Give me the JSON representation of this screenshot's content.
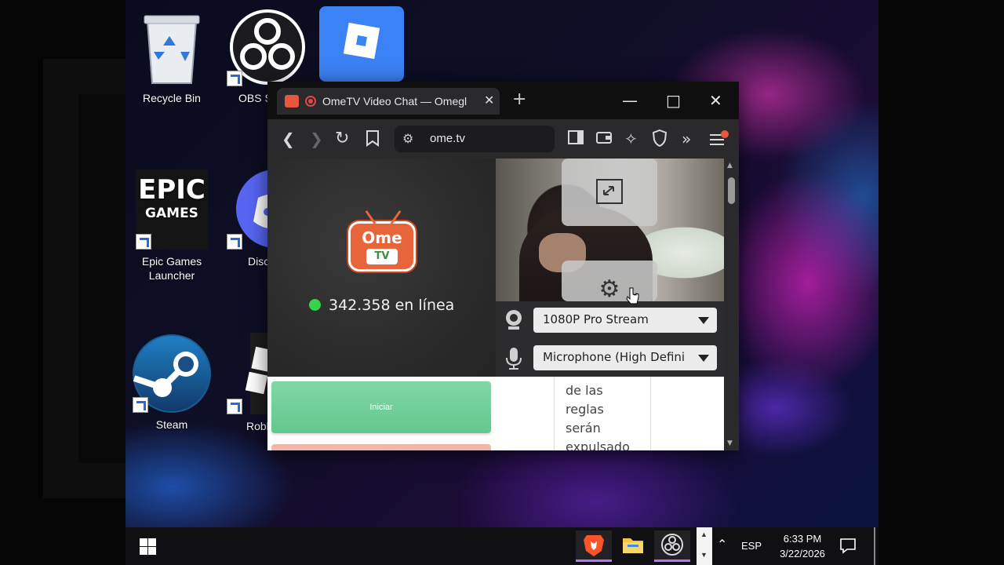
{
  "desktop": {
    "icons": [
      {
        "label": "Recycle Bin"
      },
      {
        "label": "OBS S"
      },
      {
        "label": "Epic Games Launcher"
      },
      {
        "label": "Disc"
      },
      {
        "label": "Steam"
      },
      {
        "label": "Roblox"
      }
    ],
    "epic_logo": {
      "line1": "EPIC",
      "line2": "GAMES"
    }
  },
  "browser": {
    "tab_title": "OmeTV Video Chat — Omegl",
    "url": "ome.tv",
    "window_controls": {
      "minimize": "—",
      "maximize": "□",
      "close": "✕"
    }
  },
  "page": {
    "logo": {
      "line1": "Ome",
      "line2": "TV"
    },
    "online_count": "342.358 en línea",
    "camera_select": "1080P Pro Stream",
    "mic_select": "Microphone (High Definit",
    "start_button": "Iniciar",
    "chat_text": [
      "de las",
      "reglas",
      "serán",
      "expulsado"
    ]
  },
  "taskbar": {
    "language": "ESP",
    "time": "6:33 PM",
    "date": "3/22/2026"
  },
  "colors": {
    "online_dot": "#34d34a",
    "start_button": "#63c88e",
    "brand": "#e8643a",
    "taskbar_active": "#b575f0"
  },
  "icons": [
    "back-arrow-icon",
    "forward-arrow-icon",
    "reload-icon",
    "bookmark-icon",
    "sidebar-icon",
    "wallet-icon",
    "leo-ai-icon",
    "shield-icon",
    "expand-icon",
    "menu-icon",
    "fullscreen-icon",
    "gear-icon",
    "webcam-icon",
    "microphone-icon"
  ]
}
